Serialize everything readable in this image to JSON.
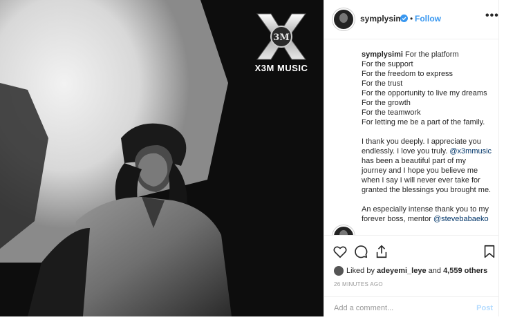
{
  "logo": {
    "monogram": "3M",
    "text": "X3M MUSIC"
  },
  "header": {
    "username": "symplysimi",
    "separator": "•",
    "follow_label": "Follow",
    "more_label": "•••"
  },
  "caption": {
    "username": "symplysimi",
    "lines": [
      "For the platform",
      "For the support",
      "For the freedom to express",
      "For the trust",
      "For the opportunity to live my dreams",
      "For the growth",
      "For the teamwork",
      "For letting me be a part of the family."
    ],
    "para2_before": "I thank you deeply. I appreciate you endlessly. I love you truly. ",
    "para2_mention": "@x3mmusic",
    "para2_after": " has been a beautiful part of my journey and I hope you believe me when I say I will never ever take for granted the blessings you brought me.",
    "para3_before": "An especially intense thank you to my forever boss, mentor ",
    "para3_mention": "@stevebabaeko"
  },
  "likes": {
    "prefix": "Liked by ",
    "user": "adeyemi_leye",
    "middle": " and ",
    "count": "4,559 others"
  },
  "timestamp": "26 MINUTES AGO",
  "comment": {
    "placeholder": "Add a comment...",
    "post_label": "Post"
  },
  "colors": {
    "link": "#3897f0",
    "verified": "#3897f0",
    "muted": "#999999"
  }
}
